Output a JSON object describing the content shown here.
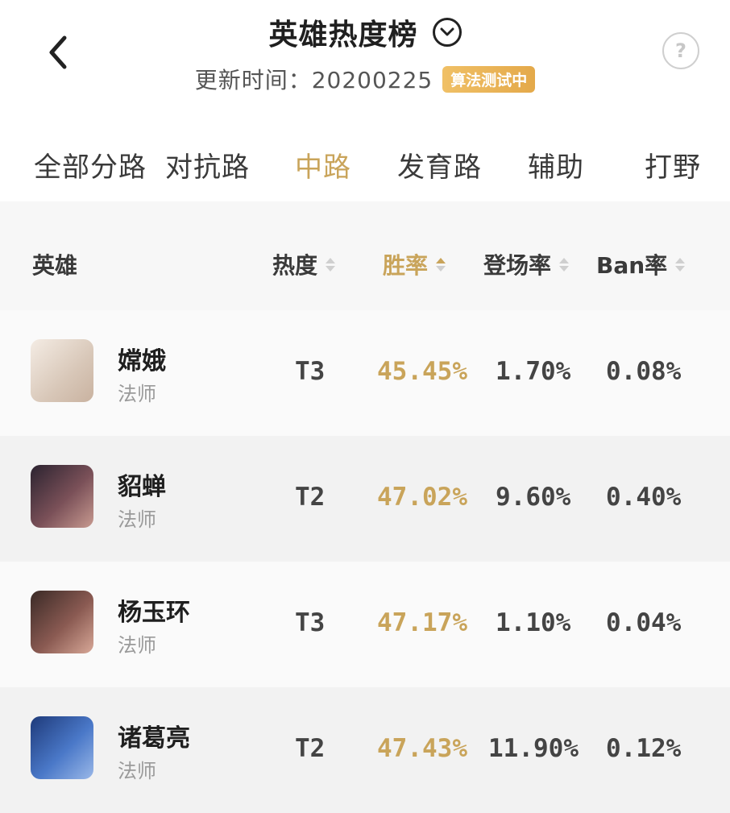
{
  "header": {
    "title": "英雄热度榜",
    "update_text": "更新时间：20200225",
    "badge": "算法测试中",
    "help": "?"
  },
  "tabs": [
    {
      "label": "全部分路",
      "active": false
    },
    {
      "label": "对抗路",
      "active": false
    },
    {
      "label": "中路",
      "active": true
    },
    {
      "label": "发育路",
      "active": false
    },
    {
      "label": "辅助",
      "active": false
    },
    {
      "label": "打野",
      "active": false
    }
  ],
  "columns": {
    "hero": "英雄",
    "heat": "热度",
    "win_rate": "胜率",
    "pick_rate": "登场率",
    "ban_rate": "Ban率"
  },
  "rows": [
    {
      "name": "嫦娥",
      "role": "法师",
      "tier": "T3",
      "win": "45.45%",
      "pick": "1.70%",
      "ban": "0.08%",
      "avatar_color": "#e8ddd2"
    },
    {
      "name": "貂蝉",
      "role": "法师",
      "tier": "T2",
      "win": "47.02%",
      "pick": "9.60%",
      "ban": "0.40%",
      "avatar_color": "#5a3a44"
    },
    {
      "name": "杨玉环",
      "role": "法师",
      "tier": "T3",
      "win": "47.17%",
      "pick": "1.10%",
      "ban": "0.04%",
      "avatar_color": "#6a4a46"
    },
    {
      "name": "诸葛亮",
      "role": "法师",
      "tier": "T2",
      "win": "47.43%",
      "pick": "11.90%",
      "ban": "0.12%",
      "avatar_color": "#3a5fa8"
    }
  ],
  "colors": {
    "accent": "#c9a45a",
    "text": "#3a3a3a",
    "muted": "#9a9a9a"
  }
}
